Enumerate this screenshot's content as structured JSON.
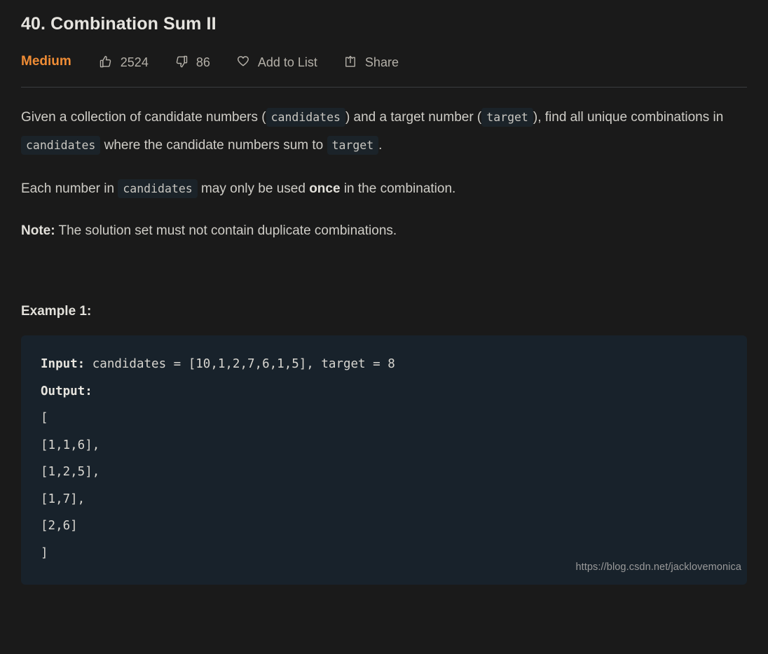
{
  "problem": {
    "title": "40. Combination Sum II",
    "difficulty": "Medium",
    "likes": "2524",
    "dislikes": "86",
    "add_to_list_label": "Add to List",
    "share_label": "Share"
  },
  "description": {
    "p1_a": "Given a collection of candidate numbers (",
    "p1_code1": "candidates",
    "p1_b": ") and a target number (",
    "p1_code2": "target",
    "p1_c": "), find all unique combinations in",
    "p1_code3": "candidates",
    "p1_d": "where the candidate numbers sum to",
    "p1_code4": "target",
    "p1_e": ".",
    "p2_a": "Each number in",
    "p2_code1": "candidates",
    "p2_b": "may only be used",
    "p2_bold": "once",
    "p2_c": "in the combination.",
    "p3_bold": "Note:",
    "p3_text": "The solution set must not contain duplicate combinations."
  },
  "example": {
    "heading": "Example 1:",
    "input_label": "Input:",
    "input_value": " candidates = [10,1,2,7,6,1,5], target = 8",
    "output_label": "Output:",
    "output_lines": [
      "[",
      "[1,1,6],",
      "[1,2,5],",
      "[1,7],",
      "[2,6]",
      "]"
    ]
  },
  "watermark": "https://blog.csdn.net/jacklovemonica",
  "colors": {
    "page_bg": "#1a1a1a",
    "difficulty_orange": "#ef8c35",
    "code_bg": "#18222b",
    "inline_code_bg": "#1b2329",
    "divider": "#3a3d40"
  }
}
